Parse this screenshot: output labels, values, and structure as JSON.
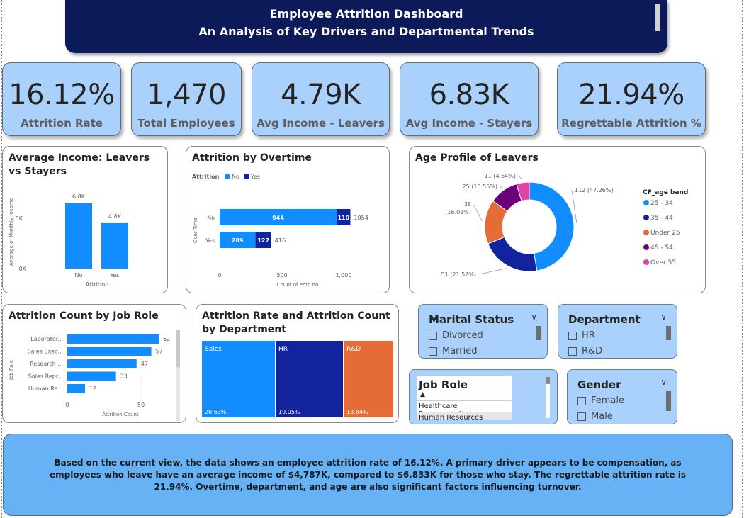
{
  "header": {
    "title": "Employee Attrition Dashboard",
    "subtitle": "An Analysis of Key Drivers and Departmental Trends"
  },
  "kpis": [
    {
      "value": "16.12%",
      "label": "Attrition Rate"
    },
    {
      "value": "1,470",
      "label": "Total Employees"
    },
    {
      "value": "4.79K",
      "label": "Avg Income - Leavers"
    },
    {
      "value": "6.83K",
      "label": "Avg Income - Stayers"
    },
    {
      "value": "21.94%",
      "label": "Regrettable Attrition %"
    }
  ],
  "income_chart": {
    "title": "Average Income: Leavers vs Stayers",
    "ylabel": "Average of Monthly Income",
    "xlabel": "Attrition",
    "y_ticks": [
      "0K",
      "5K"
    ]
  },
  "overtime_chart": {
    "title": "Attrition by Overtime",
    "legend_title": "Attrition",
    "legend": [
      "No",
      "Yes"
    ],
    "ylabel": "Over Time",
    "xlabel": "Count of emp no",
    "x_ticks": [
      "0",
      "500",
      "1,000"
    ]
  },
  "age_chart": {
    "title": "Age Profile of Leavers",
    "legend_title": "CF_age band"
  },
  "jobrole_chart": {
    "title": "Attrition Count by Job Role",
    "ylabel": "Job Role",
    "xlabel": "Attrition Count",
    "x_ticks": [
      "0",
      "50"
    ]
  },
  "dept_chart": {
    "title": "Attrition Rate and Attrition Count by Department"
  },
  "chart_data": [
    {
      "type": "bar",
      "title": "Average Income: Leavers vs Stayers",
      "categories": [
        "No",
        "Yes"
      ],
      "values": [
        6833,
        4787
      ],
      "data_labels": [
        "6.8K",
        "4.8K"
      ],
      "xlabel": "Attrition",
      "ylabel": "Average of Monthly Income",
      "ylim": [
        0,
        7500
      ],
      "color": "#118dff"
    },
    {
      "type": "bar",
      "orientation": "horizontal",
      "stacked": true,
      "title": "Attrition by Overtime",
      "categories": [
        "No",
        "Yes"
      ],
      "series": [
        {
          "name": "No",
          "values": [
            944,
            289
          ],
          "color": "#118dff"
        },
        {
          "name": "Yes",
          "values": [
            110,
            127
          ],
          "color": "#12239e"
        }
      ],
      "totals": [
        1054,
        416
      ],
      "xlabel": "Count of emp no",
      "ylabel": "Over Time",
      "xlim": [
        0,
        1100
      ]
    },
    {
      "type": "pie",
      "donut": true,
      "title": "Age Profile of Leavers",
      "legend_title": "CF_age band",
      "categories": [
        "25 - 34",
        "35 - 44",
        "Under 25",
        "45 - 54",
        "Over 55"
      ],
      "values": [
        112,
        51,
        38,
        25,
        11
      ],
      "labels": [
        "112 (47.26%)",
        "51 (21.52%)",
        "38 (16.03%)",
        "25 (10.55%)",
        "11 (4.64%)"
      ],
      "colors": [
        "#118dff",
        "#12239e",
        "#e66c37",
        "#6b007b",
        "#e044a7"
      ],
      "legend_position": "right"
    },
    {
      "type": "bar",
      "orientation": "horizontal",
      "title": "Attrition Count by Job Role",
      "categories": [
        "Laborator...",
        "Sales Exec...",
        "Research ...",
        "Sales Repr...",
        "Human Re..."
      ],
      "values": [
        62,
        57,
        47,
        33,
        12
      ],
      "xlabel": "Attrition Count",
      "ylabel": "Job Role",
      "xlim": [
        0,
        70
      ],
      "color": "#118dff"
    },
    {
      "type": "heatmap",
      "subtype": "treemap",
      "title": "Attrition Rate and Attrition Count by Department",
      "categories": [
        "Sales",
        "HR",
        "R&D"
      ],
      "rates": [
        "20.63%",
        "19.05%",
        "13.84%"
      ],
      "colors": [
        "#118dff",
        "#12239e",
        "#e66c37"
      ]
    }
  ],
  "slicers": {
    "marital": {
      "title": "Marital Status",
      "items": [
        "Divorced",
        "Married"
      ]
    },
    "department": {
      "title": "Department",
      "items": [
        "HR",
        "R&D"
      ]
    },
    "jobrole": {
      "title": "Job Role",
      "items": [
        "Healthcare Representative",
        "Human Resources"
      ]
    },
    "gender": {
      "title": "Gender",
      "items": [
        "Female",
        "Male"
      ]
    }
  },
  "summary": "Based on the current view, the data shows an employee attrition rate of 16.12%. A primary driver appears to be compensation, as employees who leave have an average income of $4,787K, compared to $6,833K for those who stay. The regrettable attrition rate is 21.94%. Overtime, department, and age are also significant factors influencing turnover."
}
